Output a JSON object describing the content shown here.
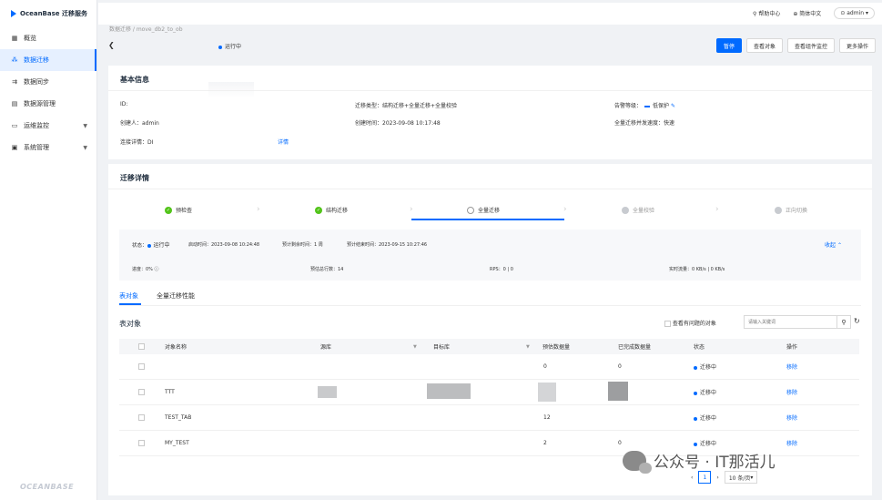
{
  "app": {
    "title": "OceanBase 迁移服务",
    "footer": "OCEANBASE"
  },
  "sidebar": {
    "items": [
      {
        "label": "概览",
        "icon": "grid-icon"
      },
      {
        "label": "数据迁移",
        "icon": "flow-icon",
        "active": true
      },
      {
        "label": "数据同步",
        "icon": "sync-icon"
      },
      {
        "label": "数据源管理",
        "icon": "database-icon"
      },
      {
        "label": "运维监控",
        "icon": "monitor-icon",
        "expandable": true
      },
      {
        "label": "系统管理",
        "icon": "settings-icon",
        "expandable": true
      }
    ]
  },
  "topbar": {
    "help": "帮助中心",
    "lang": "简体中文",
    "user": "admin"
  },
  "breadcrumb": "数据迁移 / move_db2_to_ob",
  "header": {
    "status": "运行中",
    "buttons": [
      "暂停",
      "查看对象",
      "查看组件监控",
      "更多操作"
    ]
  },
  "basic_info": {
    "title": "基本信息",
    "id_label": "ID:",
    "migration_type": "迁移类型：结构迁移+全量迁移+全量校验",
    "alert_level_label": "告警等级：",
    "alert_level": "低保护",
    "creator": "创建人：admin",
    "created_time": "创建时间：2023-09-08 10:17:48",
    "concurrency": "全量迁移并发速度：快速",
    "conn_label": "连接详情：DI",
    "conn_link": "详情"
  },
  "migration": {
    "title": "迁移详情",
    "steps": [
      {
        "label": "预检查",
        "state": "done"
      },
      {
        "label": "结构迁移",
        "state": "done"
      },
      {
        "label": "全量迁移",
        "state": "current"
      },
      {
        "label": "全量校验",
        "state": "wait"
      },
      {
        "label": "正向切换",
        "state": "wait"
      }
    ],
    "status_label": "状态：",
    "status": "运行中",
    "start_time": "启动时间：2023-09-08 10:24:48",
    "remaining": "预计剩余时间：1 周",
    "end_time": "预计结束时间：2023-09-15 10:27:46",
    "collapse": "收起",
    "progress": "进度：0%",
    "estimated_rows": "预估总行数：14",
    "rps": "RPS：0 | 0",
    "traffic": "实时流量：0 KB/s | 0 KB/s"
  },
  "tabs": [
    "表对象",
    "全量迁移性能"
  ],
  "table_section": {
    "title": "表对象",
    "only_problem": "查看有问题的对象",
    "search_placeholder": "请输入关键词",
    "columns": [
      "对象名称",
      "源库",
      "目标库",
      "预估数据量",
      "已完成数据量",
      "状态",
      "操作"
    ],
    "rows": [
      {
        "name": "",
        "estimated": "0",
        "done": "0",
        "status": "迁移中",
        "action": "移除"
      },
      {
        "name": "TTT",
        "estimated": "",
        "done": "",
        "status": "迁移中",
        "action": "移除"
      },
      {
        "name": "TEST_TAB",
        "estimated": "12",
        "done": "",
        "status": "迁移中",
        "action": "移除"
      },
      {
        "name": "MY_TEST",
        "estimated": "2",
        "done": "0",
        "status": "迁移中",
        "action": "移除"
      }
    ]
  },
  "pagination": {
    "page": "1",
    "size": "10 条/页"
  },
  "watermark": "公众号 · IT那活儿",
  "colors": {
    "primary": "#006aff",
    "success": "#52c41a",
    "bg": "#f0f2f5"
  }
}
